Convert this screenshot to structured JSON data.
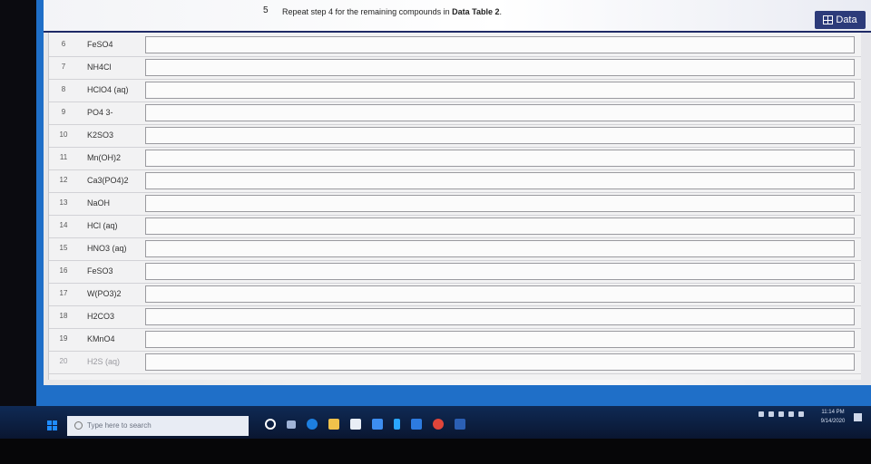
{
  "banner": {
    "step_number": "5",
    "step_text_prefix": "Repeat step 4 for the remaining compounds in ",
    "step_text_bold": "Data Table 2",
    "step_text_suffix": ".",
    "data_button_label": "Data",
    "data_button_icon": "table-icon"
  },
  "rows": [
    {
      "num": "6",
      "compound": "FeSO4",
      "answer": ""
    },
    {
      "num": "7",
      "compound": "NH4Cl",
      "answer": ""
    },
    {
      "num": "8",
      "compound": "HClO4 (aq)",
      "answer": ""
    },
    {
      "num": "9",
      "compound": "PO4 3-",
      "answer": ""
    },
    {
      "num": "10",
      "compound": "K2SO3",
      "answer": ""
    },
    {
      "num": "11",
      "compound": "Mn(OH)2",
      "answer": ""
    },
    {
      "num": "12",
      "compound": "Ca3(PO4)2",
      "answer": ""
    },
    {
      "num": "13",
      "compound": "NaOH",
      "answer": ""
    },
    {
      "num": "14",
      "compound": "HCl (aq)",
      "answer": ""
    },
    {
      "num": "15",
      "compound": "HNO3 (aq)",
      "answer": ""
    },
    {
      "num": "16",
      "compound": "FeSO3",
      "answer": ""
    },
    {
      "num": "17",
      "compound": "W(PO3)2",
      "answer": ""
    },
    {
      "num": "18",
      "compound": "H2CO3",
      "answer": ""
    },
    {
      "num": "19",
      "compound": "KMnO4",
      "answer": ""
    },
    {
      "num": "20",
      "compound": "H2S (aq)",
      "answer": ""
    }
  ],
  "taskbar": {
    "search_placeholder": "Type here to search",
    "time": "11:14 PM",
    "date": "9/14/2020",
    "icons": [
      "windows-icon",
      "cortana-icon",
      "task-view-icon",
      "edge-icon",
      "file-explorer-icon",
      "store-icon",
      "dropbox-icon",
      "bolt-icon",
      "mail-icon",
      "chrome-icon",
      "word-icon"
    ],
    "colors": {
      "taskbar": "#0f2a55",
      "accent": "#1f6fc8"
    }
  }
}
